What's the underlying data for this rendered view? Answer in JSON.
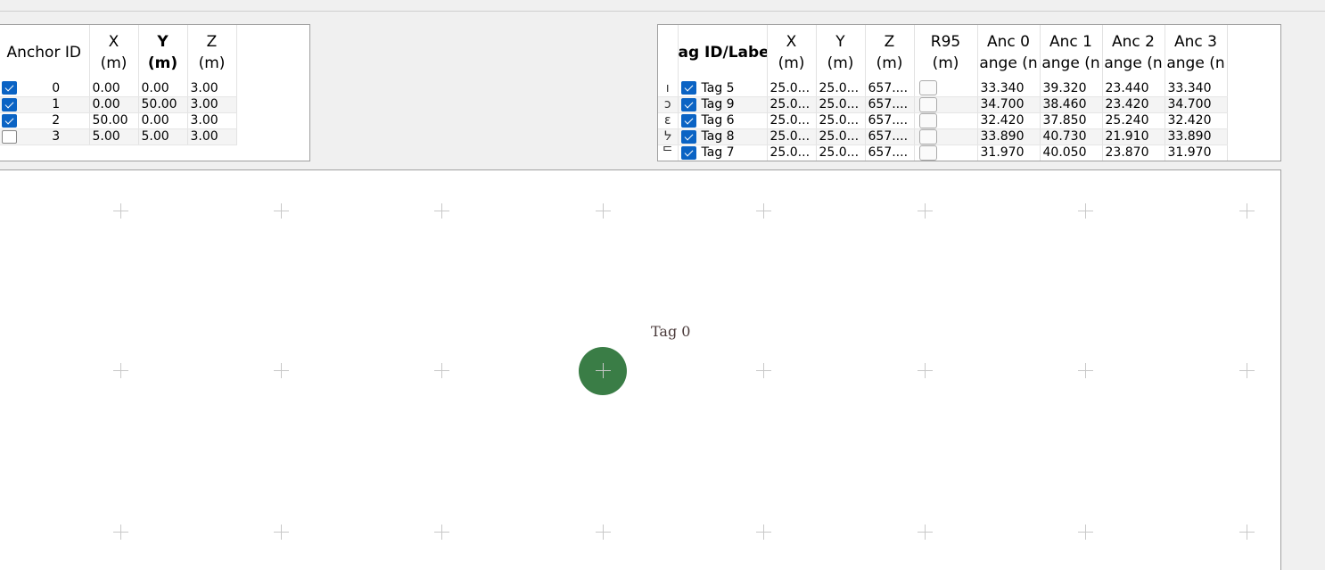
{
  "anchor_table": {
    "headers": {
      "id": "Anchor ID",
      "x": "X",
      "x_unit": "(m)",
      "y": "Y",
      "y_unit": "(m)",
      "z": "Z",
      "z_unit": "(m)"
    },
    "rows": [
      {
        "checked": true,
        "id": "0",
        "x": "0.00",
        "y": "0.00",
        "z": "3.00"
      },
      {
        "checked": true,
        "id": "1",
        "x": "0.00",
        "y": "50.00",
        "z": "3.00"
      },
      {
        "checked": true,
        "id": "2",
        "x": "50.00",
        "y": "0.00",
        "z": "3.00"
      },
      {
        "checked": false,
        "id": "3",
        "x": "5.00",
        "y": "5.00",
        "z": "3.00"
      }
    ]
  },
  "tag_table": {
    "headers": {
      "label": "ag ID/Labe",
      "x": "X",
      "x_unit": "(m)",
      "y": "Y",
      "y_unit": "(m)",
      "z": "Z",
      "z_unit": "(m)",
      "r95": "R95",
      "r95_unit": "(m)",
      "anc0": "Anc 0",
      "anc0_sub": "ange (n",
      "anc1": "Anc 1",
      "anc1_sub": "ange (n",
      "anc2": "Anc 2",
      "anc2_sub": "ange (n",
      "anc3": "Anc 3",
      "anc3_sub": "ange (n"
    },
    "rows": [
      {
        "mark": "ı",
        "checked": true,
        "label": "Tag 5",
        "x": "25.0...",
        "y": "25.0...",
        "z": "657....",
        "a0": "33.340",
        "a1": "39.320",
        "a2": "23.440",
        "a3": "33.340"
      },
      {
        "mark": "ɔ",
        "checked": true,
        "label": "Tag 9",
        "x": "25.0...",
        "y": "25.0...",
        "z": "657....",
        "a0": "34.700",
        "a1": "38.460",
        "a2": "23.420",
        "a3": "34.700"
      },
      {
        "mark": "ɛ",
        "checked": true,
        "label": "Tag 6",
        "x": "25.0...",
        "y": "25.0...",
        "z": "657....",
        "a0": "32.420",
        "a1": "37.850",
        "a2": "25.240",
        "a3": "32.420"
      },
      {
        "mark": "ᔭ",
        "checked": true,
        "label": "Tag 8",
        "x": "25.0...",
        "y": "25.0...",
        "z": "657....",
        "a0": "33.890",
        "a1": "40.730",
        "a2": "21.910",
        "a3": "33.890"
      },
      {
        "mark": "ᄃ",
        "checked": true,
        "label": "Tag 7",
        "x": "25.0...",
        "y": "25.0...",
        "z": "657....",
        "a0": "31.970",
        "a1": "40.050",
        "a2": "23.870",
        "a3": "31.970"
      }
    ]
  },
  "canvas": {
    "tag_label": "Tag 0",
    "tag_color": "#3a7d46",
    "grid_marker": "plus-icon"
  },
  "colors": {
    "checkbox": "#0a63c4",
    "background": "#f0f0f0"
  }
}
